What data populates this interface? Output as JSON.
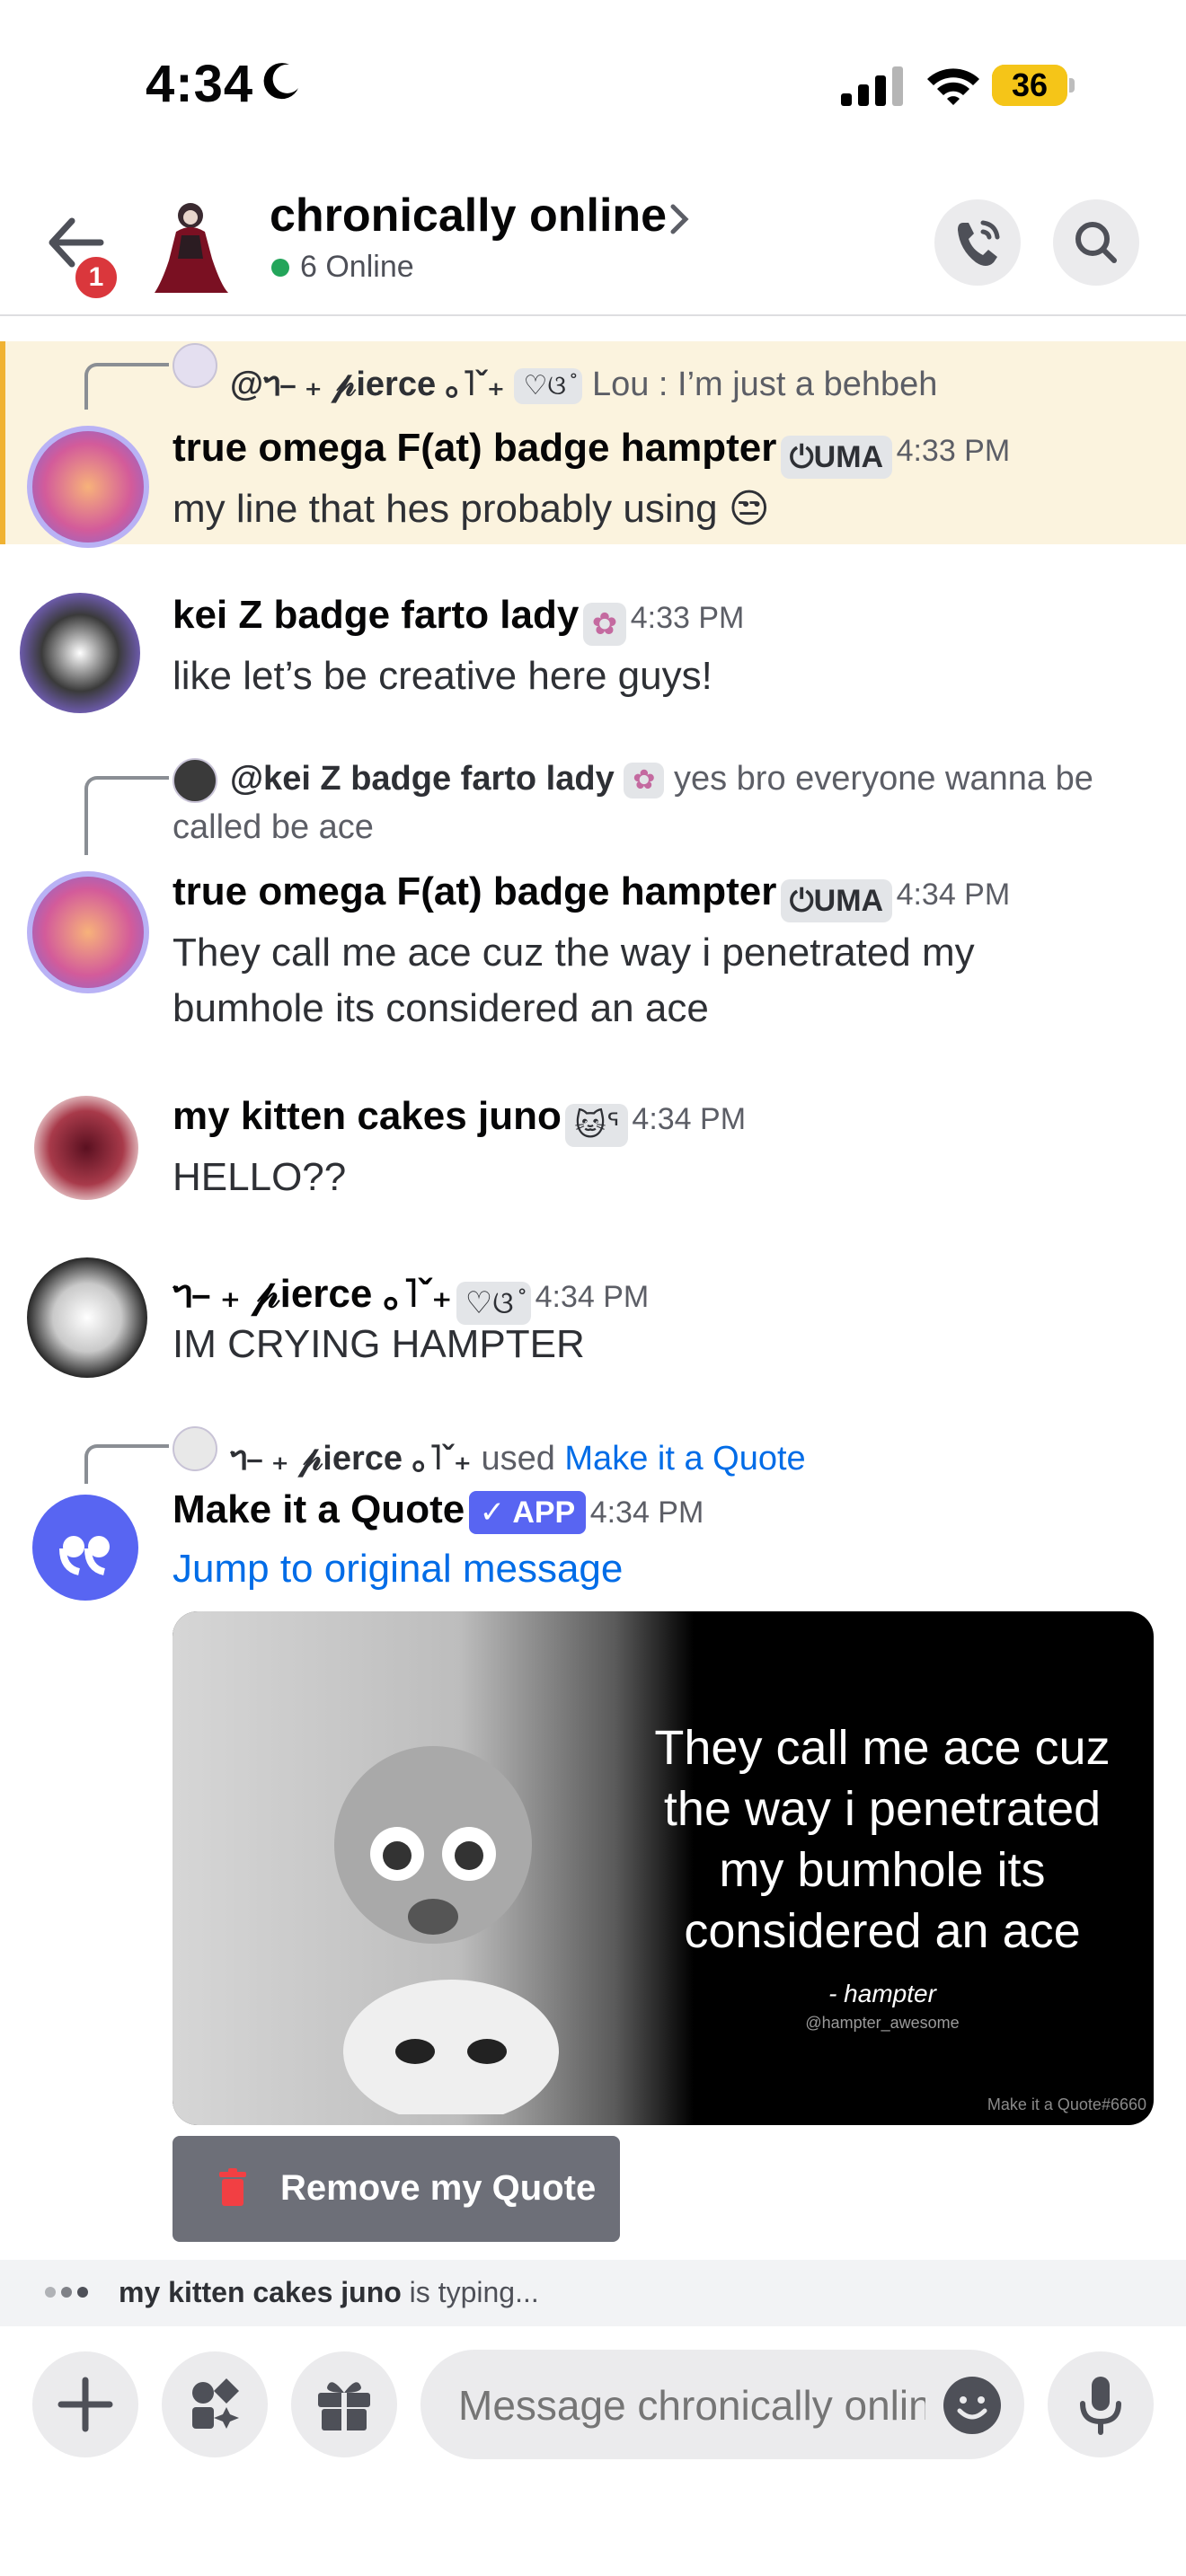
{
  "status_bar": {
    "time": "4:34",
    "battery": "36",
    "battery_level": 0.36,
    "icons": [
      "moon-icon",
      "signal-icon",
      "wifi-icon",
      "battery-icon"
    ]
  },
  "header": {
    "back_badge": "1",
    "channel_title": "chronically online",
    "online_text": "6 Online",
    "buttons": [
      "phone-call-icon",
      "search-icon"
    ]
  },
  "messages": [
    {
      "reply": {
        "mention": "@ᥐ⎯ ₊ 𝓅ierce ｡˥ˇ₊",
        "emoji": "♡ଓ ̊",
        "preview": "Lou : I’m just a behbeh"
      },
      "author": "true omega F(at) badge hampter",
      "tag": "UMA",
      "time": "4:33 PM",
      "text": "my line that hes probably using 😒",
      "highlighted": true
    },
    {
      "author": "kei Z badge farto lady",
      "tag_emoji": "✿",
      "time": "4:33 PM",
      "text": "like let’s be creative here guys!"
    },
    {
      "reply": {
        "mention": "@kei Z badge farto lady",
        "emoji": "✿",
        "preview": "yes bro everyone wanna be",
        "preview_cont": "called be ace"
      },
      "author": "true omega F(at) badge hampter",
      "tag": "UMA",
      "time": "4:34 PM",
      "text": "They call me ace cuz the way i penetrated my bumhole its considered an ace"
    },
    {
      "author": "my kitten cakes juno",
      "tag_emoji": "🐱ᕐ",
      "time": "4:34 PM",
      "text": "HELLO??"
    },
    {
      "author": "ᥐ⎯ ₊ 𝓅ierce ｡˥ˇ₊",
      "tag_emoji": "♡ଓ ̊",
      "time": "4:34 PM",
      "text": "IM CRYING HAMPTER"
    },
    {
      "reply": {
        "user": "ᥐ⎯ ₊ 𝓅ierce ｡˥ˇ₊",
        "used": "used",
        "command": "Make it a Quote"
      },
      "author": "Make it a Quote",
      "tag": "✓ APP",
      "time": "4:34 PM",
      "link": "Jump to original message",
      "quote": {
        "text": "They call me ace cuz the way i penetrated my bumhole its considered an ace",
        "author": "- hampter",
        "handle": "@hampter_awesome",
        "watermark": "Make it a Quote#6660"
      },
      "button": "Remove my Quote"
    }
  ],
  "typing": {
    "user": "my kitten cakes juno",
    "suffix": " is typing..."
  },
  "composer": {
    "placeholder": "Message chronically onlin",
    "buttons": [
      "plus-icon",
      "apps-icon",
      "gift-icon",
      "emoji-icon",
      "microphone-icon"
    ]
  },
  "colors": {
    "accent": "#5865f2",
    "link": "#006ce7",
    "online": "#23a55a",
    "badge": "#da373c",
    "highlight": "#fbf3de",
    "highlight_bar": "#f0b232",
    "button": "#6d6f78"
  }
}
